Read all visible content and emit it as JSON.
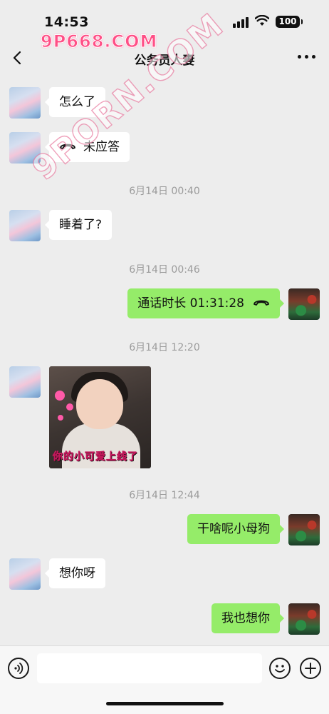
{
  "status_bar": {
    "time": "14:53",
    "battery": "100"
  },
  "watermark": {
    "top": "9P668.COM",
    "diagonal": "9PORN.COM"
  },
  "nav": {
    "title": "公务员人妻"
  },
  "messages": [
    {
      "side": "left",
      "type": "text",
      "text": "怎么了"
    },
    {
      "side": "left",
      "type": "call",
      "text": "未应答"
    },
    {
      "type": "timestamp",
      "text": "6月14日 00:40"
    },
    {
      "side": "left",
      "type": "text",
      "text": "睡着了?"
    },
    {
      "type": "timestamp",
      "text": "6月14日 00:46"
    },
    {
      "side": "right",
      "type": "call",
      "text": "通话时长 01:31:28"
    },
    {
      "type": "timestamp",
      "text": "6月14日 12:20"
    },
    {
      "side": "left",
      "type": "sticker",
      "caption": "你的小可爱上线了"
    },
    {
      "type": "timestamp",
      "text": "6月14日 12:44"
    },
    {
      "side": "right",
      "type": "text",
      "text": "干啥呢小母狗"
    },
    {
      "side": "left",
      "type": "text",
      "text": "想你呀"
    },
    {
      "side": "right",
      "type": "text",
      "text": "我也想你"
    }
  ],
  "icons": {
    "back": "chevron-left-icon",
    "more": "more-dots-icon",
    "call": "phone-hangup-icon",
    "voice": "voice-input-icon",
    "emoji": "emoji-icon",
    "plus": "plus-icon"
  },
  "colors": {
    "sent_bubble": "#95ec69",
    "received_bubble": "#ffffff",
    "background": "#ededed"
  }
}
